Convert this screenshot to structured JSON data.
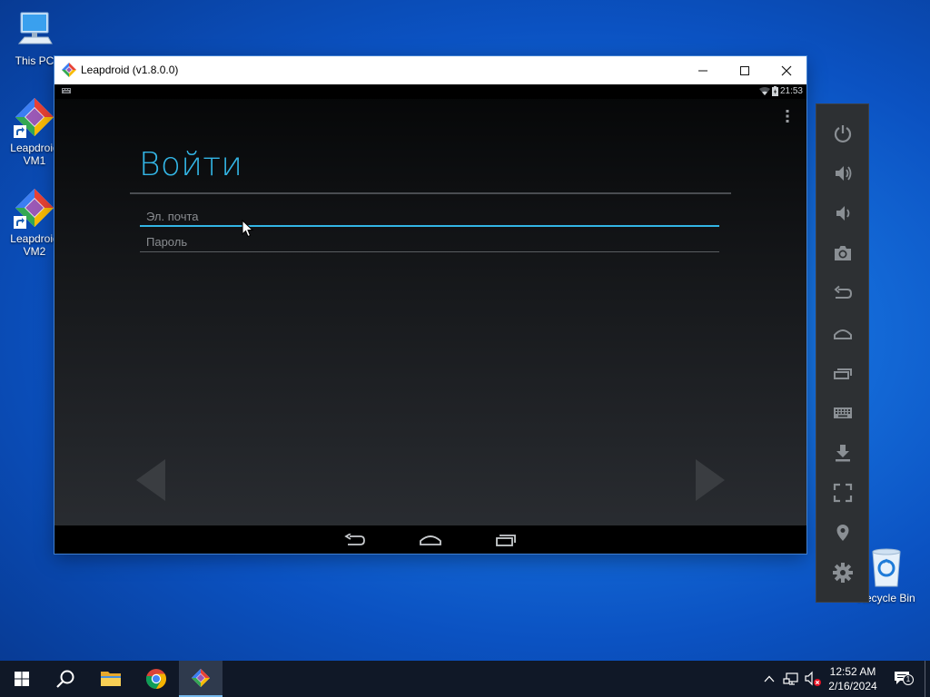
{
  "desktop": {
    "icons": [
      {
        "label": "This PC"
      },
      {
        "label": "Leapdroid VM1"
      },
      {
        "label": "Leapdroid VM2"
      }
    ],
    "recycle_bin": {
      "label": "Recycle Bin"
    }
  },
  "window": {
    "title": "Leapdroid (v1.8.0.0)"
  },
  "android": {
    "status_time": "21:53",
    "login_title": "Войти",
    "email_placeholder": "Эл. почта",
    "password_placeholder": "Пароль"
  },
  "sidebar": {
    "buttons": [
      "power-icon",
      "volume-up-icon",
      "volume-down-icon",
      "camera-icon",
      "back-icon",
      "home-icon",
      "recent-apps-icon",
      "keyboard-icon",
      "download-icon",
      "fullscreen-icon",
      "location-icon",
      "gear-icon"
    ]
  },
  "taskbar": {
    "clock_time": "12:52 AM",
    "clock_date": "2/16/2024",
    "notification_count": "1"
  },
  "colors": {
    "accent": "#33b5e5",
    "taskbar": "#101827",
    "sidebar": "#2d3033"
  }
}
